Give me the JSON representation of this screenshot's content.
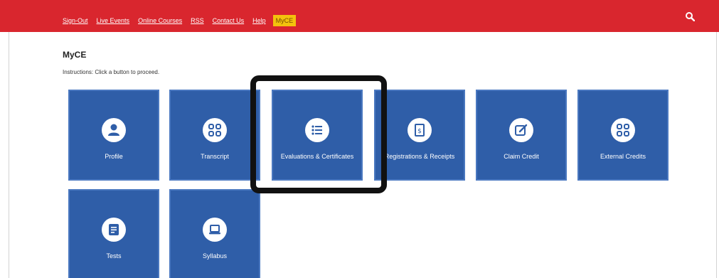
{
  "nav": {
    "items": [
      {
        "label": "Sign-Out"
      },
      {
        "label": "Live Events"
      },
      {
        "label": "Online Courses"
      },
      {
        "label": "RSS"
      },
      {
        "label": "Contact Us"
      },
      {
        "label": "Help"
      },
      {
        "label": "MyCE"
      }
    ],
    "active": "MyCE"
  },
  "page": {
    "title": "MyCE",
    "instructions": "Instructions: Click a button to proceed."
  },
  "tiles": [
    {
      "label": "Profile",
      "icon": "user-icon"
    },
    {
      "label": "Transcript",
      "icon": "grid-icon"
    },
    {
      "label": "Evaluations & Certificates",
      "icon": "list-icon"
    },
    {
      "label": "Registrations & Receipts",
      "icon": "receipt-icon"
    },
    {
      "label": "Claim Credit",
      "icon": "edit-icon"
    },
    {
      "label": "External Credits",
      "icon": "grid-icon"
    },
    {
      "label": "Tests",
      "icon": "document-icon"
    },
    {
      "label": "Syllabus",
      "icon": "laptop-icon"
    }
  ],
  "colors": {
    "topbar": "#d9262e",
    "active_nav": "#f4c20d",
    "tile": "#2f5ea8",
    "highlight": "#111111"
  }
}
